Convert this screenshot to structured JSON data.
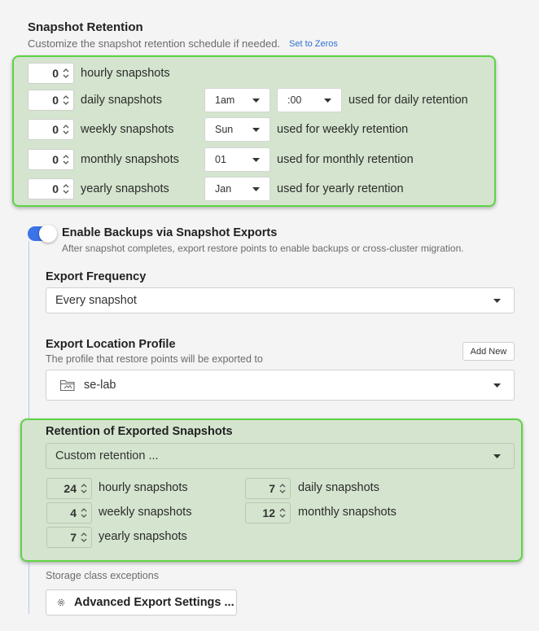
{
  "snapshot_retention": {
    "title": "Snapshot Retention",
    "subtitle": "Customize the snapshot retention schedule if needed.",
    "set_to_zeros": "Set to Zeros",
    "rows": [
      {
        "value": "0",
        "label": "hourly snapshots"
      },
      {
        "value": "0",
        "label": "daily snapshots",
        "select1": "1am",
        "select2": ":00",
        "note": "used for daily retention"
      },
      {
        "value": "0",
        "label": "weekly snapshots",
        "select1": "Sun",
        "note": "used for weekly retention"
      },
      {
        "value": "0",
        "label": "monthly snapshots",
        "select1": "01",
        "note": "used for monthly retention"
      },
      {
        "value": "0",
        "label": "yearly snapshots",
        "select1": "Jan",
        "note": "used for yearly retention"
      }
    ]
  },
  "backups": {
    "enabled": true,
    "title": "Enable Backups via Snapshot Exports",
    "description": "After snapshot completes, export restore points to enable backups or cross-cluster migration."
  },
  "export_frequency": {
    "title": "Export Frequency",
    "value": "Every snapshot"
  },
  "export_location": {
    "title": "Export Location Profile",
    "subtitle": "The profile that restore points will be exported to",
    "add_new": "Add New",
    "value": "se-lab",
    "icon": "folder-icon"
  },
  "export_retention": {
    "title": "Retention of Exported Snapshots",
    "mode": "Custom retention ...",
    "items": [
      {
        "value": "24",
        "label": "hourly snapshots"
      },
      {
        "value": "7",
        "label": "daily snapshots"
      },
      {
        "value": "4",
        "label": "weekly snapshots"
      },
      {
        "value": "12",
        "label": "monthly snapshots"
      },
      {
        "value": "7",
        "label": "yearly snapshots"
      }
    ]
  },
  "storage": {
    "label": "Storage class exceptions",
    "advanced_button": "Advanced Export Settings ...",
    "icon": "gear-icon"
  },
  "colors": {
    "highlight_fill": "#d4e4ce",
    "highlight_border": "#5ed345",
    "toggle_on": "#3b73e8",
    "link": "#2f6fd1"
  }
}
